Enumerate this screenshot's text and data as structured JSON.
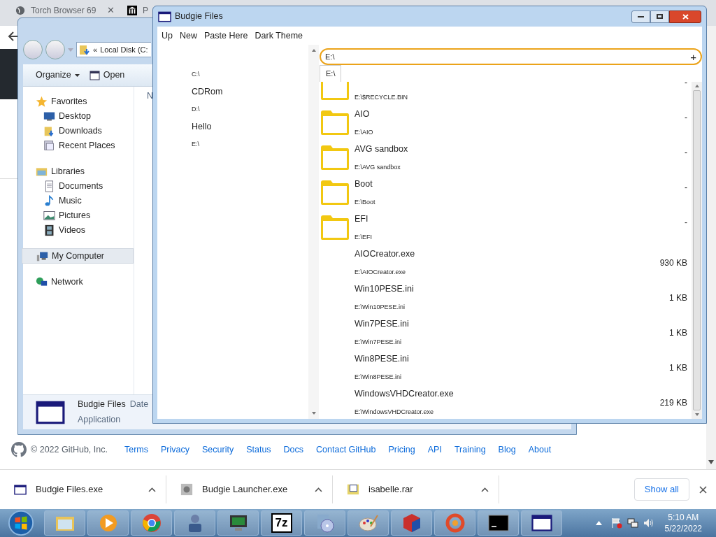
{
  "browser": {
    "tabs": [
      {
        "label": "Torch Browser 69",
        "selected": false,
        "close": "✕"
      },
      {
        "label": "P",
        "selected": false
      }
    ],
    "footer": {
      "copyright": "© 2022 GitHub, Inc.",
      "links": [
        "Terms",
        "Privacy",
        "Security",
        "Status",
        "Docs",
        "Contact GitHub",
        "Pricing",
        "API",
        "Training",
        "Blog",
        "About"
      ]
    },
    "downloads": {
      "items": [
        {
          "name": "Budgie Files.exe",
          "kind": "window"
        },
        {
          "name": "Budgie Launcher.exe",
          "kind": "launcher"
        },
        {
          "name": "isabelle.rar",
          "kind": "archive"
        }
      ],
      "show_all": "Show all"
    }
  },
  "explorer": {
    "address_prefix": "«",
    "address": "Local Disk (C:",
    "toolbar": [
      "Organize",
      "Open"
    ],
    "nav": [
      {
        "label": "Favorites",
        "kind": "favorites",
        "selected": false,
        "children": [
          {
            "label": "Desktop",
            "kind": "desktop"
          },
          {
            "label": "Downloads",
            "kind": "downloads"
          },
          {
            "label": "Recent Places",
            "kind": "recent"
          }
        ]
      },
      {
        "label": "Libraries",
        "kind": "libraries",
        "selected": false,
        "children": [
          {
            "label": "Documents",
            "kind": "documents"
          },
          {
            "label": "Music",
            "kind": "music"
          },
          {
            "label": "Pictures",
            "kind": "pictures"
          },
          {
            "label": "Videos",
            "kind": "videos"
          }
        ]
      },
      {
        "label": "My Computer",
        "kind": "computer",
        "selected": true
      },
      {
        "label": "Network",
        "kind": "network",
        "selected": false
      }
    ],
    "column_1": "N",
    "details": {
      "name": "Budgie Files",
      "column_2": "Date",
      "type": "Application"
    }
  },
  "budgie": {
    "title": "Budgie Files",
    "menu": [
      "Up",
      "New",
      "Paste Here",
      "Dark Theme"
    ],
    "drives": [
      {
        "label": "C:\\",
        "kind": "path"
      },
      {
        "label": "CDRom",
        "kind": "name"
      },
      {
        "label": "D:\\",
        "kind": "path"
      },
      {
        "label": "Hello",
        "kind": "name"
      },
      {
        "label": "E:\\",
        "kind": "path"
      }
    ],
    "path_field": "E:\\",
    "add_button": "+",
    "tabs": [
      {
        "label": "E:\\",
        "selected": true
      }
    ],
    "files": [
      {
        "kind": "folder",
        "path": "E:\\$RECYCLE.BIN",
        "size": "-"
      },
      {
        "kind": "folder",
        "name": "AIO",
        "path": "E:\\AIO",
        "size": "-"
      },
      {
        "kind": "folder",
        "name": "AVG sandbox",
        "path": "E:\\AVG sandbox",
        "size": "-"
      },
      {
        "kind": "folder",
        "name": "Boot",
        "path": "E:\\Boot",
        "size": "-"
      },
      {
        "kind": "folder",
        "name": "EFI",
        "path": "E:\\EFI",
        "size": "-"
      },
      {
        "kind": "file",
        "name": "AIOCreator.exe",
        "path": "E:\\AIOCreator.exe",
        "size": "930 KB"
      },
      {
        "kind": "file",
        "name": "Win10PESE.ini",
        "path": "E:\\Win10PESE.ini",
        "size": "1 KB"
      },
      {
        "kind": "file",
        "name": "Win7PESE.ini",
        "path": "E:\\Win7PESE.ini",
        "size": "1 KB"
      },
      {
        "kind": "file",
        "name": "Win8PESE.ini",
        "path": "E:\\Win8PESE.ini",
        "size": "1 KB"
      },
      {
        "kind": "file",
        "name": "WindowsVHDCreator.exe",
        "path": "E:\\WindowsVHDCreator.exe",
        "size": "219 KB"
      }
    ]
  },
  "taskbar": {
    "apps": [
      {
        "kind": "folder"
      },
      {
        "kind": "media"
      },
      {
        "kind": "browser"
      },
      {
        "kind": "figure"
      },
      {
        "kind": "monitor"
      },
      {
        "kind": "archive",
        "label": "7z"
      },
      {
        "kind": "disc"
      },
      {
        "kind": "paint"
      },
      {
        "kind": "cube"
      },
      {
        "kind": "ring"
      },
      {
        "kind": "terminal"
      },
      {
        "kind": "window"
      }
    ],
    "time": "5:10 AM",
    "date": "5/22/2022"
  }
}
